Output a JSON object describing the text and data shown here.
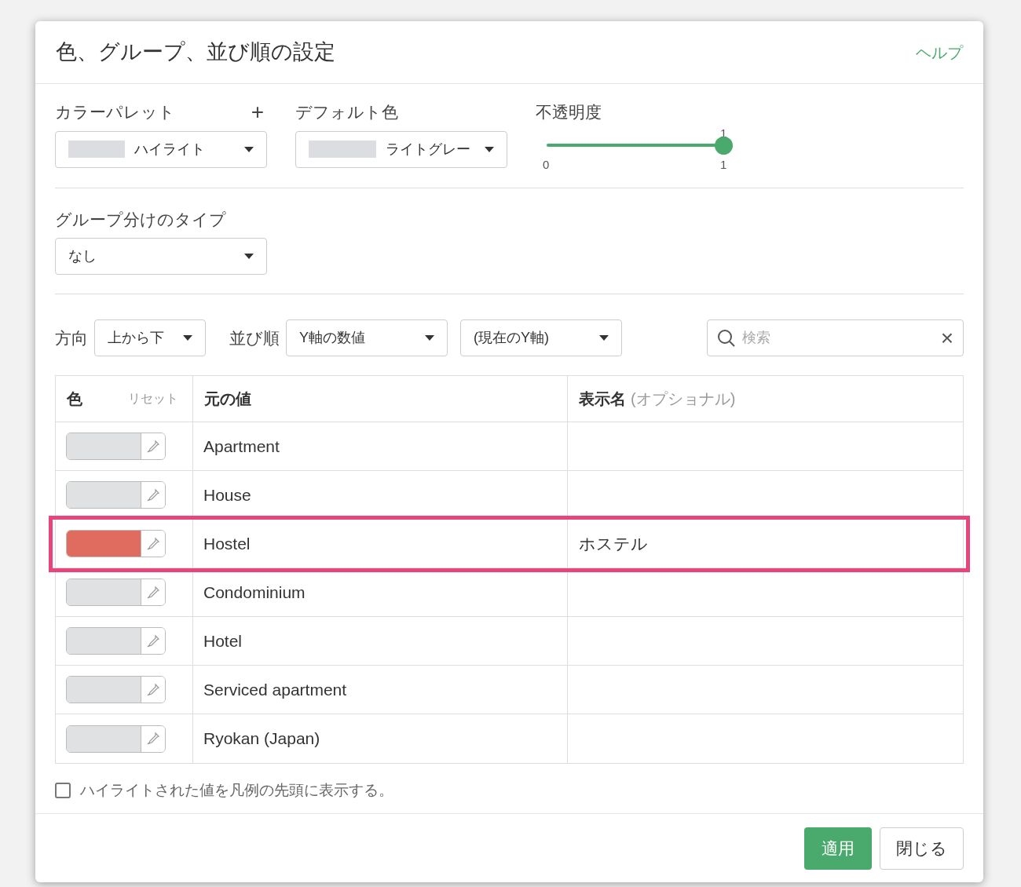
{
  "dialog": {
    "title": "色、グループ、並び順の設定",
    "help": "ヘルプ"
  },
  "palette": {
    "label": "カラーパレット",
    "add": "+",
    "value": "ハイライト",
    "color": "#dcdde0"
  },
  "default_color": {
    "label": "デフォルト色",
    "value": "ライトグレー",
    "color": "#dcdde0"
  },
  "opacity": {
    "label": "不透明度",
    "level": 1,
    "min": "0",
    "max": "1",
    "reading": "1"
  },
  "grouping": {
    "label": "グループ分けのタイプ",
    "value": "なし"
  },
  "direction": {
    "label": "方向",
    "value": "上から下"
  },
  "sort": {
    "label": "並び順",
    "value": "Y軸の数値",
    "axis": "(現在のY軸)"
  },
  "search": {
    "placeholder": "検索",
    "clear": "×"
  },
  "table": {
    "columns": [
      {
        "label": "色",
        "action": "リセット"
      },
      {
        "label": "元の値"
      },
      {
        "label": "表示名",
        "hint": "(オプショナル)"
      }
    ],
    "rows": [
      {
        "color": "#e0e1e3",
        "value": "Apartment",
        "selected": false
      },
      {
        "color": "#e0e1e3",
        "value": "House",
        "selected": false
      },
      {
        "color": "#e06c5f",
        "value": "Hostel",
        "display": "ホステル",
        "selected": true
      },
      {
        "color": "#e0e1e3",
        "value": "Condominium",
        "selected": false
      },
      {
        "color": "#e0e1e3",
        "value": "Hotel",
        "selected": false
      },
      {
        "color": "#e0e1e3",
        "value": "Serviced apartment",
        "selected": false
      },
      {
        "color": "#e0e1e3",
        "value": "Ryokan (Japan)",
        "selected": false
      }
    ]
  },
  "legend_first": {
    "label": "ハイライトされた値を凡例の先頭に表示する。",
    "checked": false
  },
  "buttons": {
    "apply": "適用",
    "close": "閉じる"
  }
}
